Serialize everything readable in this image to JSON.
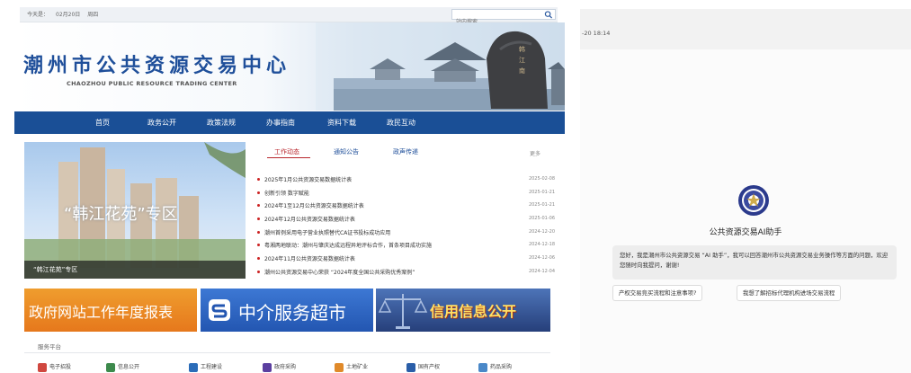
{
  "site": {
    "topbar": {
      "date_label": "今天是：",
      "date": "02月20日",
      "weekday": "周四",
      "search_placeholder": "站内搜索"
    },
    "banner": {
      "title": "潮州市公共资源交易中心",
      "subtitle": "CHAOZHOU PUBLIC RESOURCE TRADING CENTER"
    },
    "nav": [
      "首页",
      "政务公开",
      "政策法规",
      "办事指南",
      "资料下载",
      "政民互动"
    ],
    "slide": {
      "title": "“韩江花苑”专区",
      "caption": "“韩江花苑”专区"
    },
    "news": {
      "tabs": [
        "工作动态",
        "通知公告",
        "政声传递"
      ],
      "more": "更多",
      "items": [
        {
          "title": "2025年1月公共资源交易数据统计表",
          "date": "2025-02-08"
        },
        {
          "title": "创新引领 数字赋能",
          "date": "2025-01-21"
        },
        {
          "title": "2024年1至12月公共资源交易数据统计表",
          "date": "2025-01-21"
        },
        {
          "title": "2024年12月公共资源交易数据统计表",
          "date": "2025-01-06"
        },
        {
          "title": "潮州首例采用电子营业执照替代CA证书投标成功应用",
          "date": "2024-12-20"
        },
        {
          "title": "粤湘两地联动：潮州与肇庆达成远程异地评标合作，首条项目成功实施",
          "date": "2024-12-18"
        },
        {
          "title": "2024年11月公共资源交易数据统计表",
          "date": "2024-12-06"
        },
        {
          "title": "潮州公共资源交易中心荣获 “2024年度全国公共采购优秀案例”",
          "date": "2024-12-04"
        }
      ]
    },
    "ads": [
      "政府网站工作年度报表",
      "中介服务超市",
      "信用信息公开"
    ],
    "service": {
      "label": "服务平台",
      "items": [
        "电子招投",
        "信息公开",
        "工程建设",
        "政府采购",
        "土地矿业",
        "国有产权",
        "药品采购"
      ]
    }
  },
  "chat": {
    "time": "-20 18:14",
    "assistant_name": "公共资源交易AI助手",
    "greeting": "您好，我是潮州市公共资源交易 “AI 助手”，我可以回答潮州市公共资源交易业务操作等方面的问题，欢迎您随时向我提问，谢谢!",
    "suggestions": [
      "产权交易竞买流程和注意事项?",
      "我想了解招标代理机构进场交易流程"
    ]
  },
  "colors": {
    "nav_bg": "#1a4f96",
    "title_blue": "#1f4f9a",
    "news_accent": "#b8262c",
    "ad_orange": "#e6781c",
    "ad_blue": "#2356b1",
    "ad_navy": "#263f7a"
  }
}
